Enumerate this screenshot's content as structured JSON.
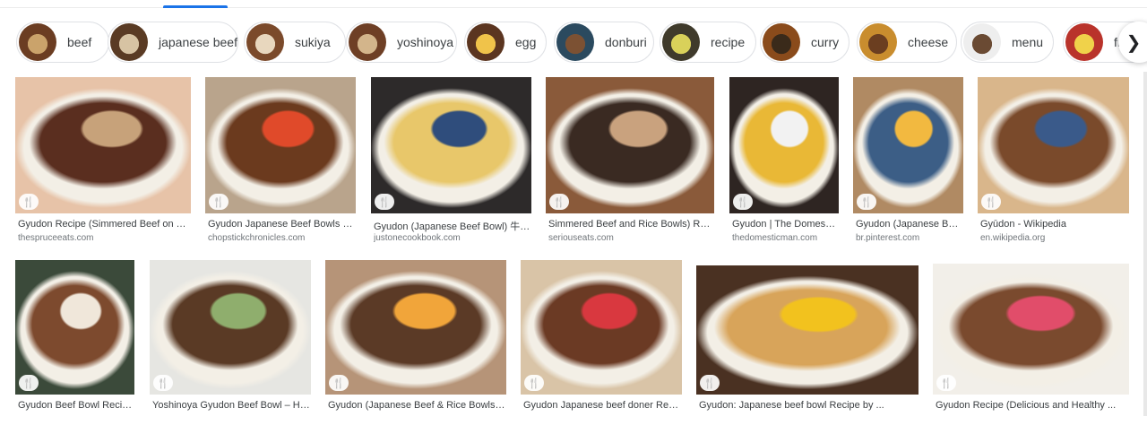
{
  "chips": [
    {
      "label": "beef",
      "colors": [
        "#6b3d22",
        "#caa36b"
      ]
    },
    {
      "label": "japanese beef",
      "colors": [
        "#5a3b24",
        "#d7c3a3"
      ]
    },
    {
      "label": "sukiya",
      "colors": [
        "#7b4a2b",
        "#e8d7be"
      ]
    },
    {
      "label": "yoshinoya",
      "colors": [
        "#6e3f25",
        "#d3b58b"
      ]
    },
    {
      "label": "egg",
      "colors": [
        "#5b3520",
        "#f0c34a"
      ]
    },
    {
      "label": "donburi",
      "colors": [
        "#2b4a5f",
        "#7c5133"
      ]
    },
    {
      "label": "recipe",
      "colors": [
        "#3f3a2b",
        "#d9d15a"
      ]
    },
    {
      "label": "curry",
      "colors": [
        "#8a4b1b",
        "#3a2a1a"
      ]
    },
    {
      "label": "cheese",
      "colors": [
        "#c98d2e",
        "#6b3e20"
      ]
    },
    {
      "label": "menu",
      "colors": [
        "#eeeeee",
        "#6a4a33"
      ]
    },
    {
      "label": "fre",
      "colors": [
        "#b9332b",
        "#f0d24a"
      ]
    }
  ],
  "results": [
    {
      "title": "Gyudon Recipe (Simmered Beef on Top ...",
      "source": "thespruceeats.com",
      "colors": [
        "#e7c3a8",
        "#5a2e1f",
        "#c7a27a"
      ]
    },
    {
      "title": "Gyudon Japanese Beef Bowls | C...",
      "source": "chopstickchronicles.com",
      "colors": [
        "#b9a48c",
        "#6b3a1e",
        "#e04a2a"
      ]
    },
    {
      "title": "Gyudon (Japanese Beef Bowl) 牛丼...",
      "source": "justonecookbook.com",
      "colors": [
        "#2d2a2a",
        "#e8c76a",
        "#2f4d7c"
      ]
    },
    {
      "title": "Simmered Beef and Rice Bowls) Reci...",
      "source": "seriouseats.com",
      "colors": [
        "#8a5a3a",
        "#3a2a22",
        "#c9a27e"
      ]
    },
    {
      "title": "Gyudon | The Domestic...",
      "source": "thedomesticman.com",
      "colors": [
        "#2e2522",
        "#e9b836",
        "#f2f2f2"
      ]
    },
    {
      "title": "Gyudon (Japanese Bee...",
      "source": "br.pinterest.com",
      "colors": [
        "#b08a63",
        "#3c5e86",
        "#f2b940"
      ]
    },
    {
      "title": "Gyūdon - Wikipedia",
      "source": "en.wikipedia.org",
      "colors": [
        "#d9b68b",
        "#7a4a2b",
        "#3a5a8a"
      ]
    },
    {
      "title": "Gyudon Beef Bowl Recipe ...",
      "source": "",
      "colors": [
        "#3b4a3a",
        "#7d4a2e",
        "#f0e7da"
      ]
    },
    {
      "title": "Yoshinoya Gyudon Beef Bowl – Hun...",
      "source": "",
      "colors": [
        "#e6e6e2",
        "#5a3a25",
        "#8fae6d"
      ]
    },
    {
      "title": "Gyudon (Japanese Beef & Rice Bowls ...",
      "source": "",
      "colors": [
        "#b69478",
        "#5b3a26",
        "#f1a53a"
      ]
    },
    {
      "title": "Gyudon Japanese beef doner Recip...",
      "source": "",
      "colors": [
        "#d9c4a7",
        "#6b3a24",
        "#d9383f"
      ]
    },
    {
      "title": "Gyudon: Japanese beef bowl Recipe by ...",
      "source": "",
      "colors": [
        "#4a3122",
        "#d8a45a",
        "#f2c21e"
      ]
    },
    {
      "title": "Gyudon Recipe (Delicious and Healthy ...",
      "source": "",
      "colors": [
        "#f2efe9",
        "#7a4a2e",
        "#e14d6a"
      ]
    }
  ],
  "recipe_badge_icon": "fork-knife-icon",
  "next_icon": "chevron-right-icon"
}
